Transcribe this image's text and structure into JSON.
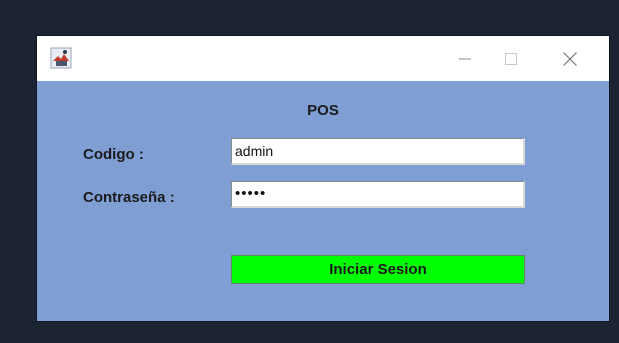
{
  "window": {
    "icons": {
      "app": "java-cup-icon",
      "minimize": "minimize-icon",
      "maximize": "maximize-icon",
      "close": "close-icon"
    },
    "colors": {
      "background": "#7f9fd4",
      "titlebar": "#ffffff",
      "button": "#00ff00"
    }
  },
  "form": {
    "title": "POS",
    "codigo_label": "Codigo :",
    "codigo_value": "admin",
    "password_label": "Contraseña :",
    "password_value": "•••••",
    "submit_label": "Iniciar Sesion"
  }
}
